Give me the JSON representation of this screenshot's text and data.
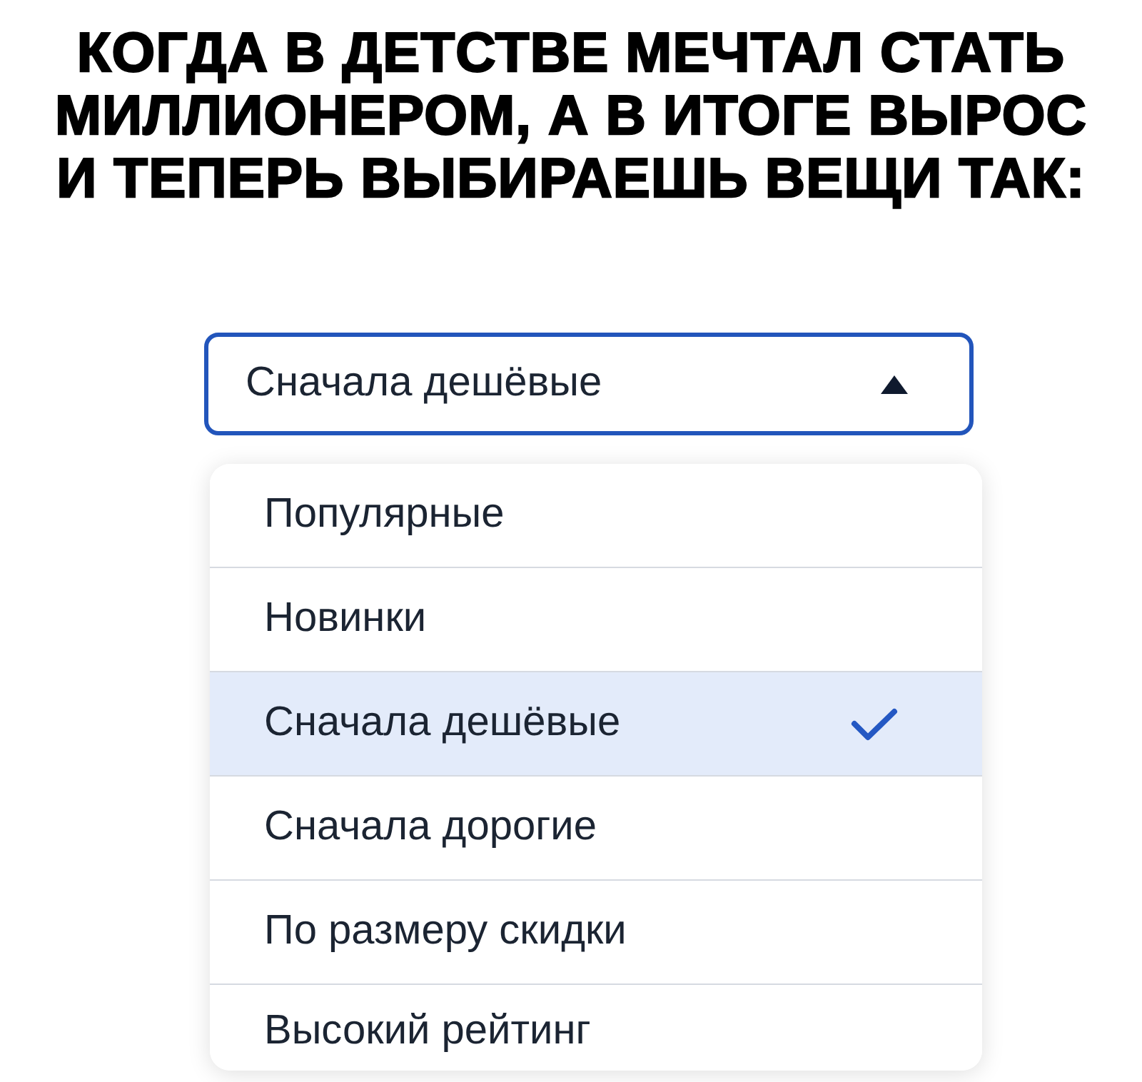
{
  "title": "КОГДА В ДЕТСТВЕ МЕЧТАЛ СТАТЬ МИЛЛИОНЕРОМ, А В ИТОГЕ ВЫРОС И ТЕПЕРЬ ВЫБИРАЕШЬ ВЕЩИ ТАК:",
  "sort_select": {
    "value": "Сначала дешёвые",
    "expanded": true
  },
  "options": [
    {
      "label": "Популярные",
      "selected": false
    },
    {
      "label": "Новинки",
      "selected": false
    },
    {
      "label": "Сначала дешёвые",
      "selected": true
    },
    {
      "label": "Сначала дорогие",
      "selected": false
    },
    {
      "label": "По размеру скидки",
      "selected": false
    },
    {
      "label": "Высокий рейтинг",
      "selected": false
    }
  ]
}
